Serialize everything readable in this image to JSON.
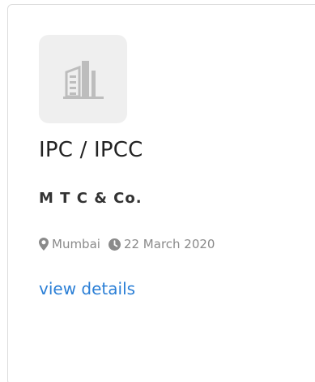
{
  "card": {
    "logo_icon": "building-icon",
    "job_title": "IPC / IPCC",
    "company_name": "M T C & Co.",
    "location": "Mumbai",
    "location_icon": "map-marker-icon",
    "date": "22 March 2020",
    "date_icon": "clock-icon",
    "link_label": "view details"
  },
  "colors": {
    "link": "#2b7fd6",
    "meta": "#8a8a8a",
    "tile": "#efefef",
    "icon": "#bdbdbd"
  }
}
